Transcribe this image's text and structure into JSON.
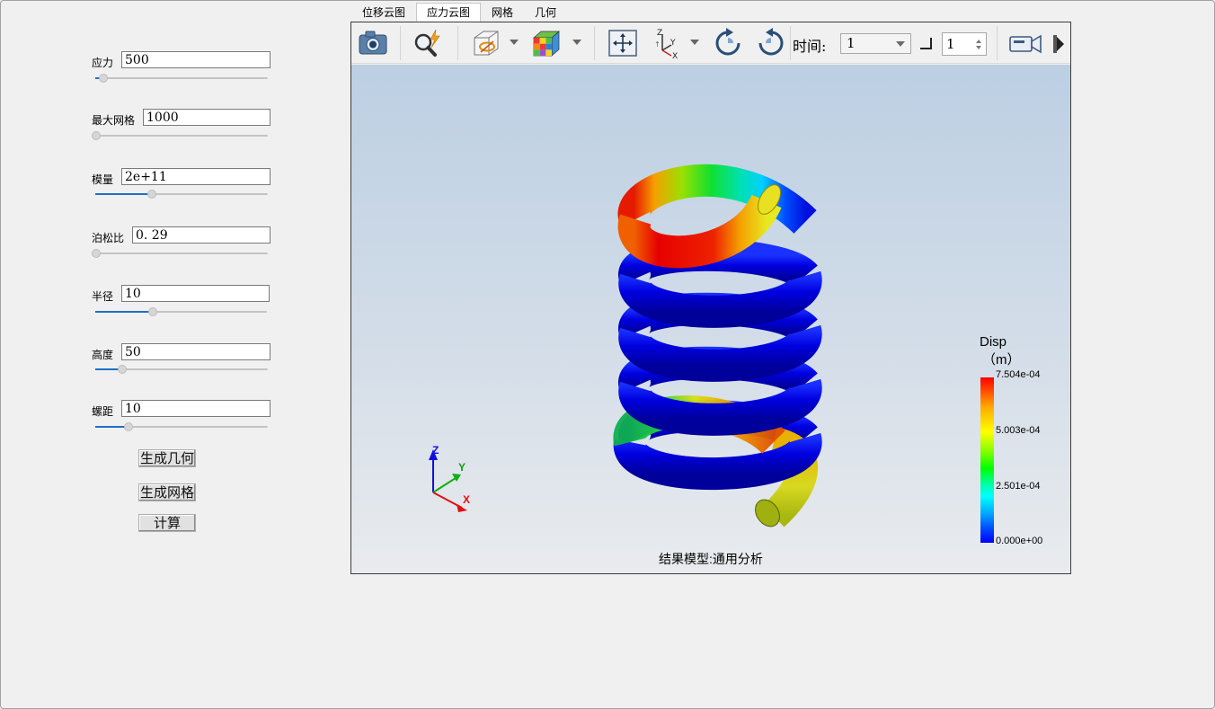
{
  "params": [
    {
      "label": "应力",
      "value": "500",
      "slider_pct": 0.05
    },
    {
      "label": "最大网格",
      "value": "1000",
      "slider_pct": 0.0
    },
    {
      "label": "模量",
      "value": "2e+11",
      "slider_pct": 0.33
    },
    {
      "label": "泊松比",
      "value": "0. 29",
      "slider_pct": 0.0
    },
    {
      "label": "半径",
      "value": "10",
      "slider_pct": 0.33
    },
    {
      "label": "高度",
      "value": "50",
      "slider_pct": 0.15
    },
    {
      "label": "螺距",
      "value": "10",
      "slider_pct": 0.2
    }
  ],
  "buttons": {
    "generate_geometry": "生成几何",
    "generate_mesh": "生成网格",
    "compute": "计算"
  },
  "tabs": [
    "位移云图",
    "应力云图",
    "网格",
    "几何"
  ],
  "active_tab": 1,
  "toolbar": {
    "icons": [
      "camera-icon",
      "zoom-icon",
      "view-box-icon",
      "color-cube-icon",
      "fit-view-icon",
      "axes-icon",
      "rotate-cw-icon",
      "rotate-ccw-icon",
      "video-icon"
    ],
    "time_label": "时间:",
    "time_value": "1",
    "step_value": "1"
  },
  "legend": {
    "title": "Disp",
    "unit": "（m）",
    "ticks": [
      "7.504e-04",
      "5.003e-04",
      "2.501e-04",
      "0.000e+00"
    ]
  },
  "axes": {
    "z": "Z",
    "y": "Y",
    "x": "X"
  },
  "model_label": "结果模型:通用分析"
}
